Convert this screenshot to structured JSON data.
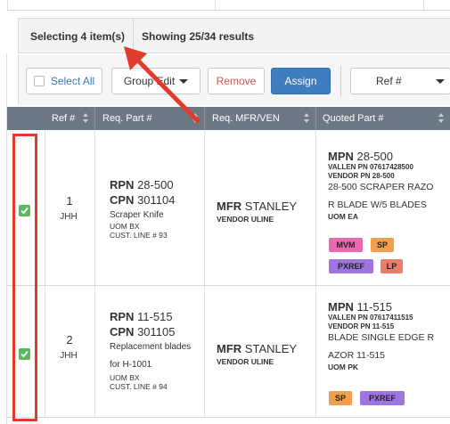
{
  "selection": {
    "selecting_text": "Selecting 4 item(s)",
    "showing_text": "Showing 25/34 results"
  },
  "toolbar": {
    "select_all_label": "Select All",
    "group_edit_label": "Group Edit",
    "remove_label": "Remove",
    "assign_label": "Assign",
    "ref_select_value": "Ref #"
  },
  "table": {
    "headers": [
      "Ref #",
      "Req. Part #",
      "Req. MFR/VEN",
      "Quoted Part #"
    ],
    "rows": [
      {
        "checked": true,
        "ref": "1",
        "initials": "JHH",
        "rpn_label": "RPN",
        "rpn": "28-500",
        "cpn_label": "CPN",
        "cpn": "301104",
        "description": [
          "Scraper Knife"
        ],
        "uom": "UOM BX",
        "cust_line": "CUST. LINE # 93",
        "mfr_label": "MFR",
        "mfr": "STANLEY",
        "vendor": "VENDOR ULINE",
        "mpn_label": "MPN",
        "mpn": "28-500",
        "vallen_pn": "VALLEN PN 07617428500",
        "vendor_pn": "VENDOR PN 28-500",
        "quoted_desc": [
          "28-500 SCRAPER RAZO",
          "R BLADE W/5 BLADES"
        ],
        "quoted_uom": "UOM EA",
        "tags": [
          "MVM",
          "SP",
          "PXREF",
          "LP"
        ]
      },
      {
        "checked": true,
        "ref": "2",
        "initials": "JHH",
        "rpn_label": "RPN",
        "rpn": "11-515",
        "cpn_label": "CPN",
        "cpn": "301105",
        "description": [
          "Replacement blades",
          "for H-1001"
        ],
        "uom": "UOM BX",
        "cust_line": "CUST. LINE # 94",
        "mfr_label": "MFR",
        "mfr": "STANLEY",
        "vendor": "VENDOR ULINE",
        "mpn_label": "MPN",
        "mpn": "11-515",
        "vallen_pn": "VALLEN PN 07617411515",
        "vendor_pn": "VENDOR PN 11-515",
        "quoted_desc": [
          "BLADE SINGLE EDGE R",
          "AZOR 11-515"
        ],
        "quoted_uom": "UOM PK",
        "tags": [
          "SP",
          "PXREF"
        ]
      }
    ]
  },
  "colors": {
    "header_bg": "#6e7784",
    "assign_bg": "#3e7dbf",
    "remove_text": "#d9534f",
    "checkbox_green": "#5cb85c",
    "annotation_red": "#e23b2e",
    "tag_mvm": "#ec69b2",
    "tag_sp": "#f0a04c",
    "tag_pxref": "#9d75e0",
    "tag_lp": "#ef7b6b"
  },
  "icons": [
    "checkbox-checked-icon",
    "sort-icon",
    "caret-down-icon",
    "annotation-arrow-icon"
  ]
}
